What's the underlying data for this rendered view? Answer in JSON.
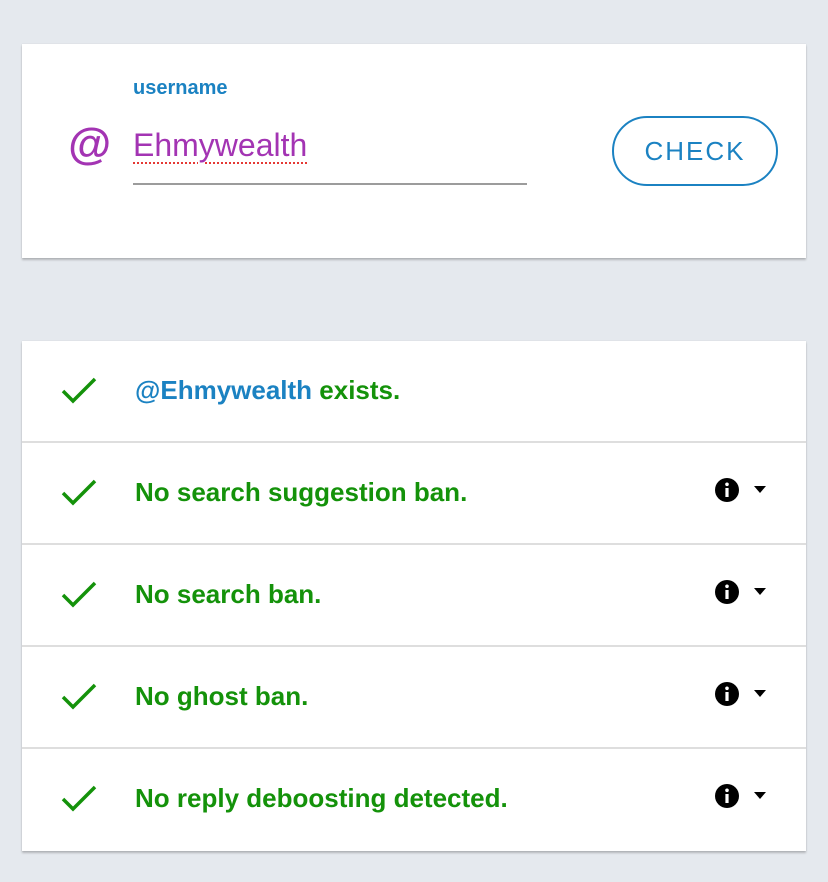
{
  "search": {
    "label": "username",
    "value": "Ehmywealth",
    "prefix_icon": "at-icon",
    "button_label": "CHECK"
  },
  "results": [
    {
      "handle": "@Ehmywealth",
      "text": " exists.",
      "status": "ok",
      "has_info": false
    },
    {
      "text": "No search suggestion ban.",
      "status": "ok",
      "has_info": true
    },
    {
      "text": "No search ban.",
      "status": "ok",
      "has_info": true
    },
    {
      "text": "No ghost ban.",
      "status": "ok",
      "has_info": true
    },
    {
      "text": "No reply deboosting detected.",
      "status": "ok",
      "has_info": true
    }
  ],
  "colors": {
    "accent": "#1b82c2",
    "success": "#14920a",
    "username": "#a334b3",
    "background": "#e5e9ee"
  }
}
